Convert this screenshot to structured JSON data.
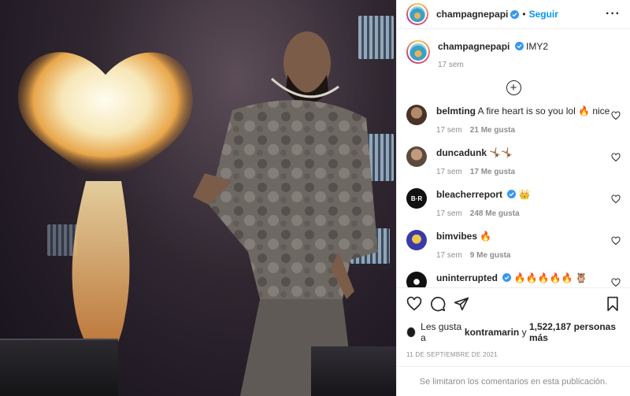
{
  "header": {
    "username": "champagnepapi",
    "separator": "•",
    "follow_label": "Seguir",
    "more_label": "···"
  },
  "caption": {
    "username": "champagnepapi",
    "text": "IMY2",
    "time": "17 sem"
  },
  "load_more_label": "+",
  "comments": [
    {
      "username": "belmting",
      "text": "A fire heart is so you lol 🔥 nice",
      "time": "17 sem",
      "likes": "21 Me gusta",
      "avatar_color": "#6b4a3a"
    },
    {
      "username": "duncadunk",
      "text": "🤸🏾🤸🏾",
      "time": "17 sem",
      "likes": "17 Me gusta",
      "avatar_color": "#8a6a55"
    },
    {
      "username": "bleacherreport",
      "verified": true,
      "text": "👑",
      "time": "17 sem",
      "likes": "248 Me gusta",
      "avatar_color": "#111111",
      "avatar_text": "B·R"
    },
    {
      "username": "bimvibes",
      "text": "🔥",
      "time": "17 sem",
      "likes": "9 Me gusta",
      "avatar_color": "#3a3aa8"
    },
    {
      "username": "uninterrupted",
      "verified": true,
      "text": "🔥🔥🔥🔥🔥 🦉",
      "time": "",
      "likes": "",
      "avatar_color": "#111111"
    }
  ],
  "likes": {
    "prefix": "Les gusta a",
    "user": "kontramarin",
    "connector": "y",
    "count": "1,522,187 personas más"
  },
  "date": "11 DE SEPTIEMBRE DE 2021",
  "limited_notice": "Se limitaron los comentarios en esta publicación.",
  "colors": {
    "accent": "#0095f6",
    "verified": "#3897f0",
    "muted": "#8e8e8e"
  }
}
